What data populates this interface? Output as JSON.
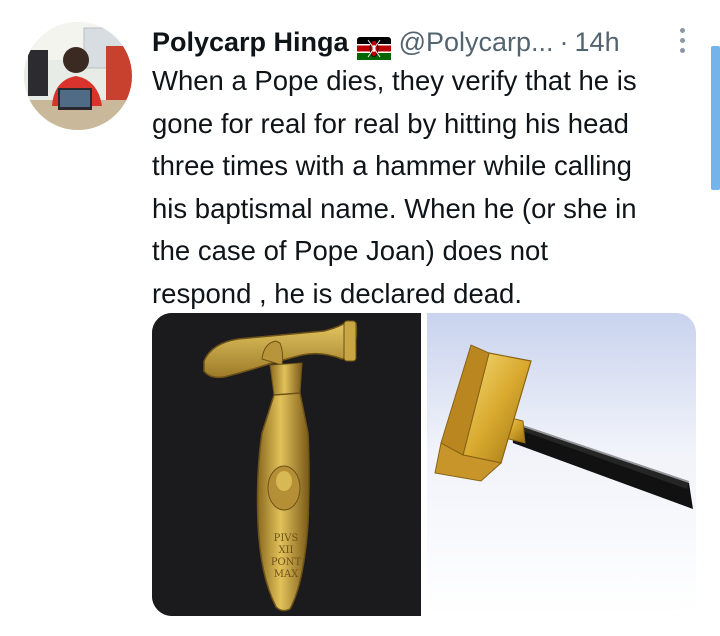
{
  "tweet": {
    "author_name": "Polycarp Hinga",
    "handle": "@Polycarp...",
    "separator": "·",
    "timestamp": "14h",
    "text_lines": [
      "When a Pope dies, they verify that he is",
      "gone for real for real by hitting his head",
      "three times with a hammer while calling",
      "his baptismal name. When he (or she in",
      "the case of Pope Joan) does not",
      "respond , he is declared dead."
    ],
    "hammer_inscription": [
      "PIVS",
      "XII",
      "PONT",
      "MAX"
    ]
  },
  "icons": {
    "avatar": "profile-photo",
    "flag": "kenya-flag-icon",
    "more": "more-vertical-icon"
  },
  "colors": {
    "text_primary": "#0f1419",
    "text_secondary": "#536471",
    "scrollbar": "#74b4ec",
    "hammer_gold": "#c9a23a"
  }
}
